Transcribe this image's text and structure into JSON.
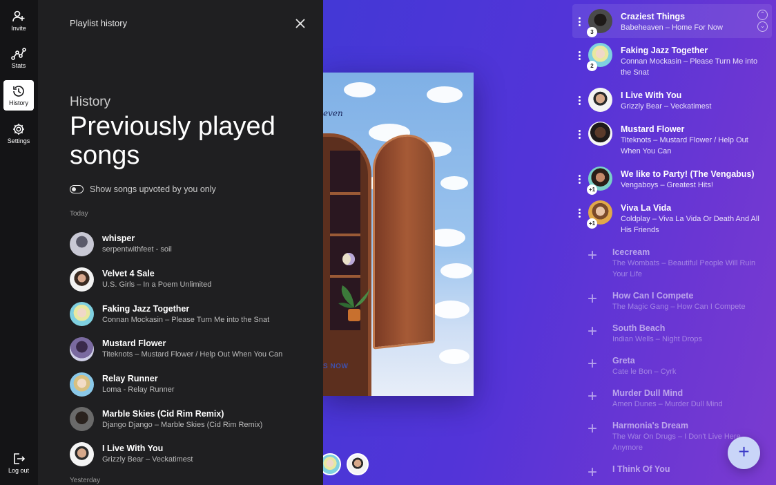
{
  "nav": {
    "items": [
      {
        "label": "Invite",
        "icon": "add-user-icon"
      },
      {
        "label": "Stats",
        "icon": "stats-icon"
      },
      {
        "label": "History",
        "icon": "history-icon",
        "active": true
      },
      {
        "label": "Settings",
        "icon": "gear-icon"
      }
    ],
    "logout_label": "Log out"
  },
  "drawer": {
    "header": "Playlist history",
    "eyebrow": "History",
    "title": "Previously played songs",
    "toggle_label": "Show songs upvoted by you only",
    "toggle_on": false,
    "sections": [
      {
        "label": "Today",
        "songs": [
          {
            "title": "whisper",
            "subtitle": "serpentwithfeet - soil"
          },
          {
            "title": "Velvet 4 Sale",
            "subtitle": "U.S. Girls – In a Poem Unlimited"
          },
          {
            "title": "Faking Jazz Together",
            "subtitle": "Connan Mockasin – Please Turn Me into the Snat"
          },
          {
            "title": "Mustard Flower",
            "subtitle": "Titeknots – Mustard Flower / Help Out When You Can"
          },
          {
            "title": "Relay Runner",
            "subtitle": "Loma - Relay Runner"
          },
          {
            "title": "Marble Skies (Cid Rim Remix)",
            "subtitle": "Django Django – Marble Skies (Cid Rim Remix)"
          },
          {
            "title": "I Live With You",
            "subtitle": "Grizzly Bear – Veckatimest"
          }
        ]
      },
      {
        "label": "Yesterday",
        "songs": []
      }
    ]
  },
  "album": {
    "script_text": "even",
    "footer_text": "S NOW"
  },
  "queue": {
    "current": {
      "title": "Craziest Things",
      "subtitle": "Babeheaven – Home For Now",
      "badge": "3"
    },
    "items": [
      {
        "title": "Faking Jazz Together",
        "subtitle": "Connan Mockasin – Please Turn Me into the Snat",
        "badge": "2"
      },
      {
        "title": "I Live With You",
        "subtitle": "Grizzly Bear – Veckatimest",
        "badge": ""
      },
      {
        "title": "Mustard Flower",
        "subtitle": "Titeknots – Mustard Flower / Help Out When You Can",
        "badge": ""
      },
      {
        "title": "We like to Party! (The Vengabus)",
        "subtitle": "Vengaboys – Greatest Hits!",
        "badge": "+1"
      },
      {
        "title": "Viva La Vida",
        "subtitle": "Coldplay – Viva La Vida Or Death And All His Friends",
        "badge": "+1"
      }
    ],
    "suggestions": [
      {
        "title": "Icecream",
        "subtitle": "The Wombats – Beautiful People Will Ruin Your Life"
      },
      {
        "title": "How Can I Compete",
        "subtitle": "The Magic Gang – How Can I Compete"
      },
      {
        "title": "South Beach",
        "subtitle": "Indian Wells – Night Drops"
      },
      {
        "title": "Greta",
        "subtitle": "Cate le Bon – Cyrk"
      },
      {
        "title": "Murder Dull Mind",
        "subtitle": "Amen Dunes – Murder Dull Mind"
      },
      {
        "title": "Harmonia's Dream",
        "subtitle": "The War On Drugs – I Don't Live Here Anymore"
      },
      {
        "title": "I Think Of You",
        "subtitle": ""
      }
    ]
  },
  "fab_icon": "plus-icon"
}
